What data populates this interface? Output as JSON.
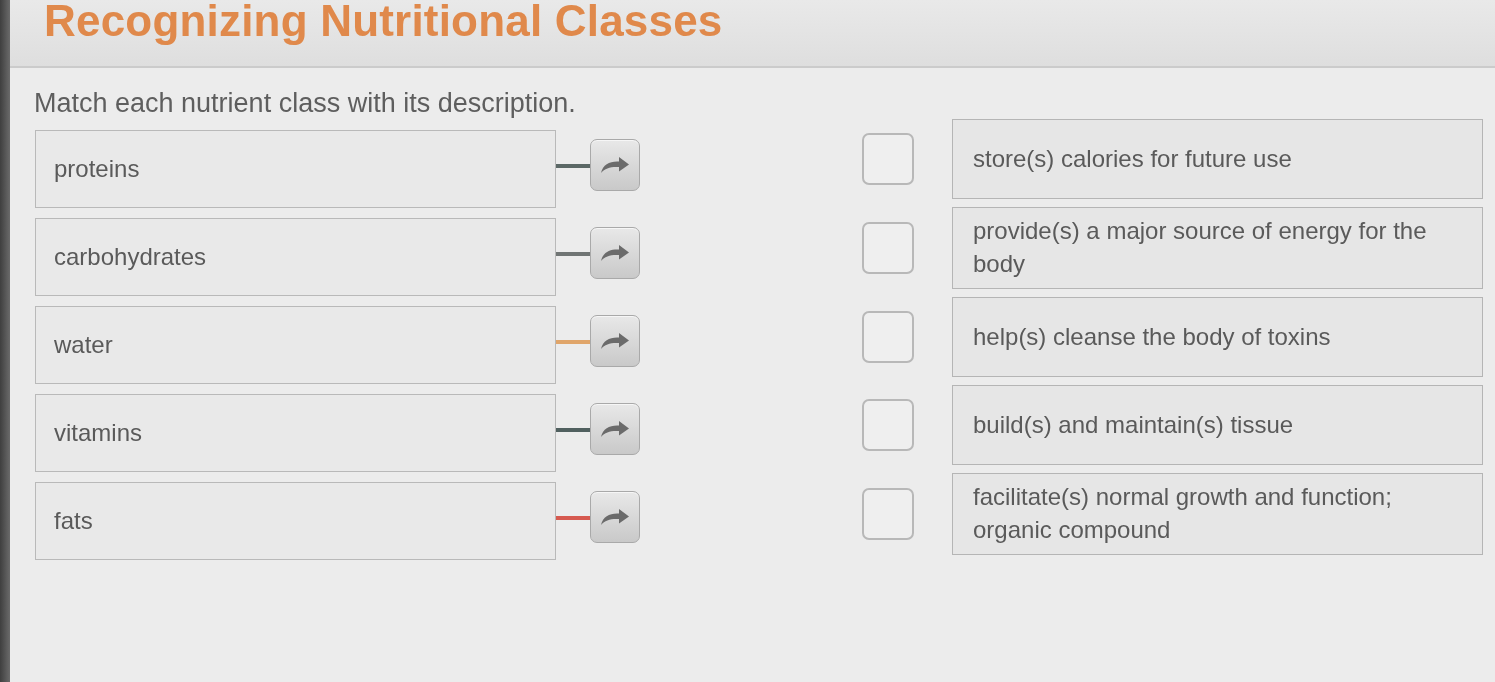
{
  "header": {
    "title": "Recognizing Nutritional Classes"
  },
  "instructions": "Match each nutrient class with its description.",
  "nutrient_classes": [
    {
      "label": "proteins",
      "color": "#5b6866"
    },
    {
      "label": "carbohydrates",
      "color": "#707574"
    },
    {
      "label": "water",
      "color": "#e0a56a"
    },
    {
      "label": "vitamins",
      "color": "#50605f"
    },
    {
      "label": "fats",
      "color": "#d65a50"
    }
  ],
  "descriptions": [
    {
      "text": "store(s) calories for future use"
    },
    {
      "text": "provide(s) a major source of energy for the body"
    },
    {
      "text": "help(s) cleanse the body of toxins"
    },
    {
      "text": "build(s) and maintain(s) tissue"
    },
    {
      "text": "facilitate(s) normal growth and function; organic compound"
    }
  ]
}
